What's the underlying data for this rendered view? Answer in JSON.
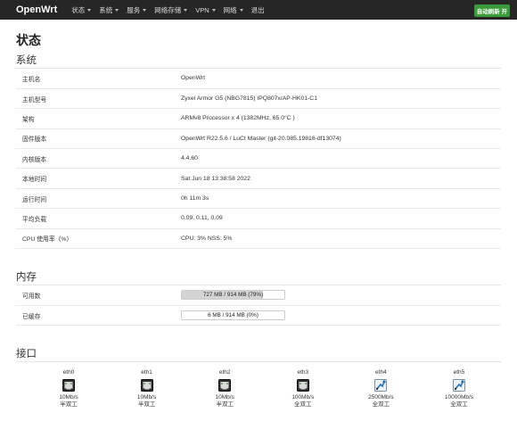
{
  "navbar": {
    "brand": "OpenWrt",
    "items": [
      {
        "label": "状态",
        "dropdown": true
      },
      {
        "label": "系统",
        "dropdown": true
      },
      {
        "label": "服务",
        "dropdown": true
      },
      {
        "label": "网络存储",
        "dropdown": true
      },
      {
        "label": "VPN",
        "dropdown": true
      },
      {
        "label": "网络",
        "dropdown": true
      },
      {
        "label": "退出",
        "dropdown": false
      }
    ],
    "refresh_label": "自动刷新 开"
  },
  "page": {
    "title": "状态"
  },
  "system": {
    "title": "系统",
    "rows": [
      {
        "key": "主机名",
        "value": "OpenWrt"
      },
      {
        "key": "主机型号",
        "value": "Zyxel Armor G5 (NBG7815) IPQ807x/AP-HK01-C1"
      },
      {
        "key": "架构",
        "value": "ARMv8 Processor x 4 (1382MHz, 65.0°C )"
      },
      {
        "key": "固件版本",
        "value": "OpenWrt R22.5.6 / LuCI Master (git-20.085.19816-df13074)"
      },
      {
        "key": "内核版本",
        "value": "4.4.60"
      },
      {
        "key": "本地时间",
        "value": "Sat Jun 18 13:38:58 2022"
      },
      {
        "key": "运行时间",
        "value": "0h 11m 3s"
      },
      {
        "key": "平均负载",
        "value": "0.09, 0.11, 0.09"
      },
      {
        "key": "CPU 使用率（%）",
        "value": "CPU: 3% NSS: 5%"
      }
    ]
  },
  "memory": {
    "title": "内存",
    "rows": [
      {
        "key": "可用数",
        "label": "727 MB / 914 MB (79%)",
        "percent": 79
      },
      {
        "key": "已缓存",
        "label": "6 MB / 914 MB (0%)",
        "percent": 0
      }
    ]
  },
  "interfaces": {
    "title": "接口",
    "ports": [
      {
        "name": "eth0",
        "speed": "10Mb/s",
        "duplex": "半双工",
        "icon": "ethernet-port-icon"
      },
      {
        "name": "eth1",
        "speed": "10Mb/s",
        "duplex": "半双工",
        "icon": "ethernet-port-icon"
      },
      {
        "name": "eth2",
        "speed": "10Mb/s",
        "duplex": "半双工",
        "icon": "ethernet-port-icon"
      },
      {
        "name": "eth3",
        "speed": "100Mb/s",
        "duplex": "全双工",
        "icon": "ethernet-port-icon"
      },
      {
        "name": "eth4",
        "speed": "2500Mb/s",
        "duplex": "全双工",
        "icon": "fiber-port-icon"
      },
      {
        "name": "eth5",
        "speed": "10000Mb/s",
        "duplex": "全双工",
        "icon": "fiber-port-icon"
      }
    ]
  },
  "colors": {
    "navbar_bg": "#262626",
    "refresh_badge": "#3a9a3a",
    "bar_fill": "#d4d4d4",
    "fiber_icon": "#2b6fb6"
  }
}
